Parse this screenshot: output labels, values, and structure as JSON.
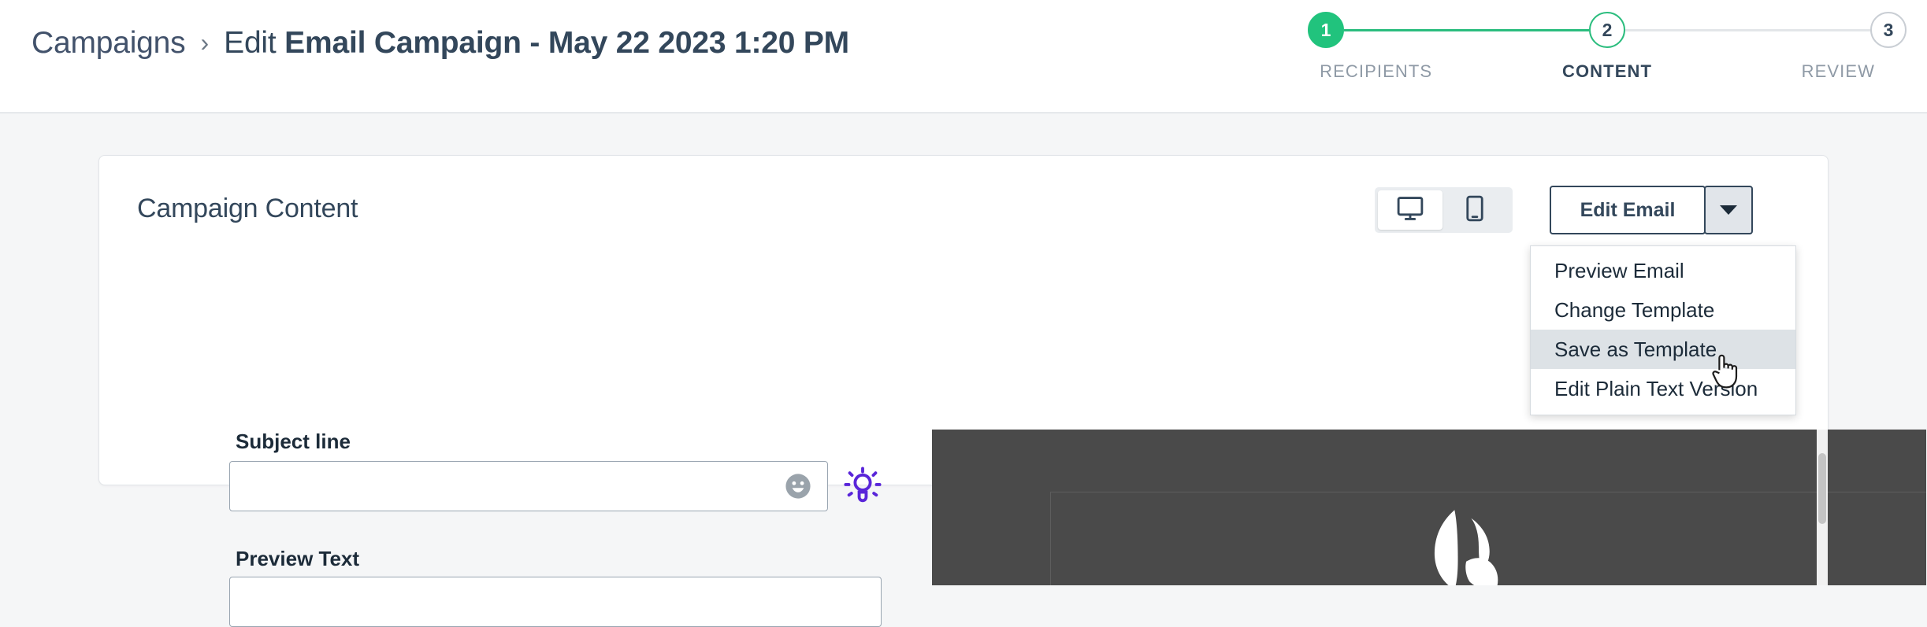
{
  "breadcrumb": {
    "parent": "Campaigns",
    "separator": "›",
    "action": "Edit",
    "campaign_name": "Email Campaign - May 22 2023 1:20 PM"
  },
  "stepper": {
    "steps": [
      {
        "number": "1",
        "label": "RECIPIENTS",
        "state": "done"
      },
      {
        "number": "2",
        "label": "CONTENT",
        "state": "current"
      },
      {
        "number": "3",
        "label": "REVIEW",
        "state": "todo"
      }
    ],
    "active_color": "#2bbd7e",
    "done_fill": "#21c37d",
    "inactive_color": "#c9ced4"
  },
  "card": {
    "title": "Campaign Content"
  },
  "toolbar": {
    "desktop_icon": "desktop-monitor-icon",
    "mobile_icon": "mobile-phone-icon",
    "active_view": "desktop",
    "edit_email_label": "Edit Email",
    "caret_icon": "chevron-down-icon"
  },
  "dropdown": {
    "open": true,
    "highlighted_index": 2,
    "items": [
      "Preview Email",
      "Change Template",
      "Save as Template",
      "Edit Plain Text Version"
    ]
  },
  "form": {
    "subject": {
      "label": "Subject line",
      "value": "",
      "placeholder": "",
      "emoji_icon": "emoji-smiley-icon",
      "assist_icon": "lightbulb-icon",
      "assist_color": "#5925d9"
    },
    "preview_text": {
      "label": "Preview Text",
      "value": "",
      "placeholder": ""
    }
  },
  "email_preview": {
    "background": "#4a4a4a",
    "logo_icon": "leaf-petal-logo"
  },
  "cursor": {
    "icon": "pointer-hand-cursor"
  }
}
